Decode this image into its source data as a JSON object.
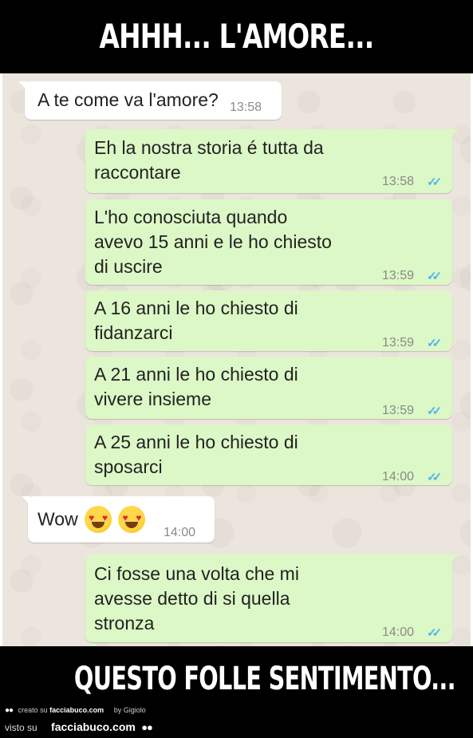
{
  "header": {
    "caption": "AHHH... L'AMORE..."
  },
  "chat": {
    "messages": [
      {
        "direction": "incoming",
        "text": "A te come va l'amore?",
        "time": "13:58"
      },
      {
        "direction": "outgoing",
        "text": "Eh la nostra storia é tutta da\nraccontare",
        "time": "13:58",
        "ticks": "✓✓"
      },
      {
        "direction": "outgoing",
        "text": "L'ho conosciuta quando\navevo 15 anni e le ho chiesto\ndi uscire",
        "time": "13:59",
        "ticks": "✓✓"
      },
      {
        "direction": "outgoing",
        "text": "A 16 anni le ho chiesto di\nfidanzarci",
        "time": "13:59",
        "ticks": "✓✓"
      },
      {
        "direction": "outgoing",
        "text": "A 21 anni le ho chiesto di\nvivere insieme",
        "time": "13:59",
        "ticks": "✓✓"
      },
      {
        "direction": "outgoing",
        "text": "A 25 anni le ho chiesto di\nsposarci",
        "time": "14:00",
        "ticks": "✓✓"
      },
      {
        "direction": "incoming",
        "text": "Wow",
        "emoji": "heart-eyes-emoji",
        "time": "14:00"
      },
      {
        "direction": "outgoing",
        "text": "Ci fosse una volta che mi\navesse detto di si quella\nstronza",
        "time": "14:00",
        "ticks": "✓✓"
      }
    ]
  },
  "footer": {
    "caption": "QUESTO FOLLE SENTIMENTO...",
    "created_text": "creato su",
    "created_site": "facciabuco.com",
    "by_text": "by Gigiolo",
    "seen_text": "visto su",
    "seen_site": "facciabuco.com"
  },
  "colors": {
    "incoming_bubble": "#ffffff",
    "outgoing_bubble": "#dcf8c6",
    "chat_background": "#ece5dd",
    "read_ticks": "#4fb6ec",
    "banner": "#000000"
  }
}
